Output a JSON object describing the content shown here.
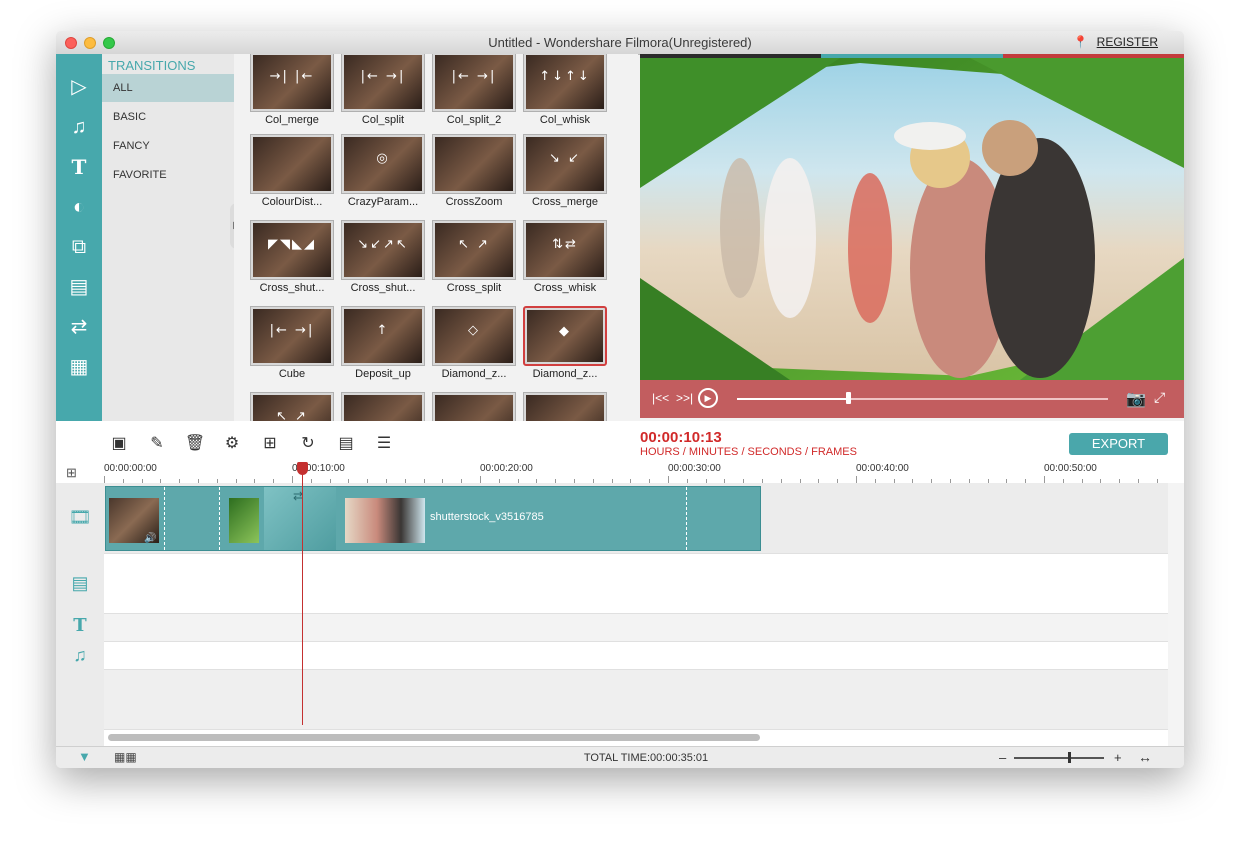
{
  "window": {
    "title": "Untitled - Wondershare Filmora(Unregistered)",
    "register": "REGISTER"
  },
  "sidebar_icons": [
    "media-icon",
    "music-icon",
    "text-icon",
    "filter-icon",
    "overlay-icon",
    "element-icon",
    "transition-icon",
    "split-screen-icon"
  ],
  "categories": {
    "title": "TRANSITIONS",
    "items": [
      "ALL",
      "BASIC",
      "FANCY",
      "FAVORITE"
    ],
    "selected": "ALL"
  },
  "transitions": [
    {
      "label": "Col_merge",
      "glyph": "→| |←"
    },
    {
      "label": "Col_split",
      "glyph": "|← →|"
    },
    {
      "label": "Col_split_2",
      "glyph": "|← →|"
    },
    {
      "label": "Col_whisk",
      "glyph": "↑↓↑↓"
    },
    {
      "label": "ColourDist...",
      "glyph": ""
    },
    {
      "label": "CrazyParam...",
      "glyph": "◎"
    },
    {
      "label": "CrossZoom",
      "glyph": ""
    },
    {
      "label": "Cross_merge",
      "glyph": "↘ ↙"
    },
    {
      "label": "Cross_shut...",
      "glyph": "◤◥◣◢"
    },
    {
      "label": "Cross_shut...",
      "glyph": "↘↙↗↖"
    },
    {
      "label": "Cross_split",
      "glyph": "↖ ↗"
    },
    {
      "label": "Cross_whisk",
      "glyph": "⇅⇄"
    },
    {
      "label": "Cube",
      "glyph": "|← →|"
    },
    {
      "label": "Deposit_up",
      "glyph": "↑"
    },
    {
      "label": "Diamond_z...",
      "glyph": "◇"
    },
    {
      "label": "Diamond_z...",
      "glyph": "◆"
    },
    {
      "label": "",
      "glyph": "↖ ↗"
    },
    {
      "label": "",
      "glyph": ""
    },
    {
      "label": "",
      "glyph": ""
    },
    {
      "label": "",
      "glyph": ""
    }
  ],
  "selected_transition_index": 15,
  "toolbar": {
    "timecode": "00:00:10:13",
    "timecode_sub": "HOURS / MINUTES / SECONDS / FRAMES",
    "export": "EXPORT",
    "tools": [
      "add-media-icon",
      "record-voiceover-icon",
      "delete-icon",
      "speed-icon",
      "crop-icon",
      "rotate-icon",
      "settings-icon",
      "adjust-icon"
    ]
  },
  "ruler": [
    "00:00:00:00",
    "00:00:10:00",
    "00:00:20:00",
    "00:00:30:00",
    "00:00:40:00",
    "00:00:50:00"
  ],
  "timeline": {
    "clip_label": "shutterstock_v3516785",
    "track_icons": [
      "video-track-icon",
      "image-track-icon",
      "text-track-icon",
      "music-track-icon"
    ]
  },
  "status": {
    "total_time": "TOTAL TIME:00:00:35:01",
    "zoom_minus": "–",
    "zoom_plus": "+"
  },
  "preview_progress": 0.3,
  "colors": {
    "accent": "#47a8ac",
    "alert": "#d12a2a",
    "preview_ctrl": "#c25d5f"
  }
}
